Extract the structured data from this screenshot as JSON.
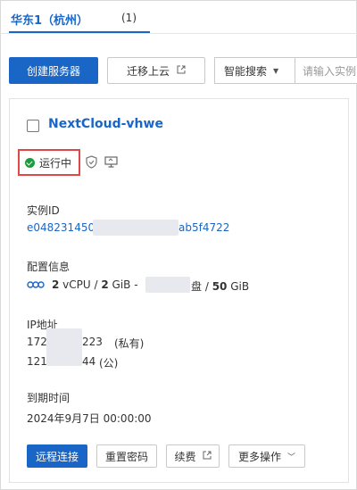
{
  "region_tab": {
    "label": "华东1（杭州）",
    "count": "(1)"
  },
  "toolbar": {
    "create_label": "创建服务器",
    "migrate_label": "迁移上云",
    "search_type": "智能搜索",
    "search_placeholder": "请输入实例"
  },
  "instance": {
    "name": "NextCloud-vhwe",
    "status": "运行中",
    "status_color": "#1a9e3c",
    "highlight_color": "#e14747",
    "id_label": "实例ID",
    "id_start": "e048231450",
    "id_end": "ab5f4722",
    "config_label": "配置信息",
    "config_vcpu": "2",
    "config_vcpu_unit": " vCPU / ",
    "config_mem": "2",
    "config_mem_unit": " GiB - ",
    "config_disk_suffix": "盘 / ",
    "config_disk": "50",
    "config_disk_unit": " GiB",
    "ip_label": "IP地址",
    "ip_private_start": "172",
    "ip_private_end": "223",
    "ip_private_tag": "(私有)",
    "ip_public_start": "121",
    "ip_public_end": "44",
    "ip_public_tag": "(公)",
    "expire_label": "到期时间",
    "expire_value": "2024年9月7日 00:00:00"
  },
  "actions": {
    "remote": "远程连接",
    "reset_password": "重置密码",
    "renew": "续费",
    "more": "更多操作"
  },
  "colors": {
    "primary": "#1a66c7"
  }
}
